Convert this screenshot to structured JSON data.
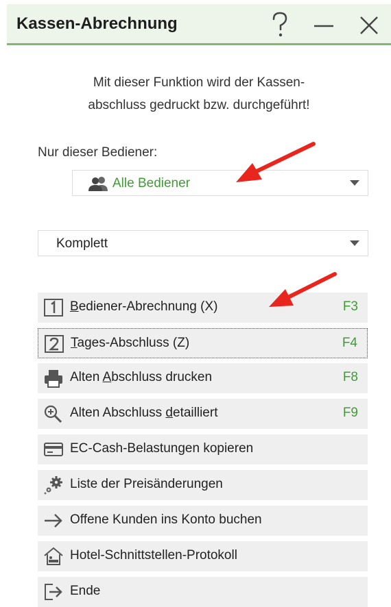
{
  "window": {
    "title": "Kassen-Abrechnung",
    "help_glyph": "?",
    "minimize_glyph": "—",
    "close_glyph": "✕"
  },
  "description": {
    "line1": "Mit dieser Funktion wird der Kassen-",
    "line2": "abschluss gedruckt bzw. durchgeführt!"
  },
  "operator_filter": {
    "label": "Nur dieser Bediener:",
    "selected": "Alle Bediener",
    "icon": "users-icon"
  },
  "mode_select": {
    "selected": "Komplett"
  },
  "actions": [
    {
      "pre": "",
      "ul": "B",
      "post": "ediener-Abrechnung (X)",
      "key": "F3",
      "icon": "number-1-icon"
    },
    {
      "pre": "",
      "ul": "T",
      "post": "ages-Abschluss (Z)",
      "key": "F4",
      "icon": "number-2-icon",
      "focused": true
    },
    {
      "pre": "Alten ",
      "ul": "A",
      "post": "bschluss drucken",
      "key": "F8",
      "icon": "printer-icon"
    },
    {
      "pre": "Alten Abschluss ",
      "ul": "d",
      "post": "etailliert",
      "key": "F9",
      "icon": "zoom-icon"
    },
    {
      "pre": "EC-Cash-Belastungen kopieren",
      "ul": "",
      "post": "",
      "key": "",
      "icon": "card-icon"
    },
    {
      "pre": "Liste der Preisänderungen",
      "ul": "",
      "post": "",
      "key": "",
      "icon": "gears-icon"
    },
    {
      "pre": "Offene Kunden ins Konto buchen",
      "ul": "",
      "post": "",
      "key": "",
      "icon": "arrow-right-icon"
    },
    {
      "pre": "Hotel-Schnittstellen-Protokoll",
      "ul": "",
      "post": "",
      "key": "",
      "icon": "hotel-icon"
    },
    {
      "pre": "Ende",
      "ul": "",
      "post": "",
      "key": "",
      "icon": "exit-icon"
    }
  ],
  "colors": {
    "accent_green": "#3f9c35",
    "title_bar": "#edf4ea",
    "title_border": "#7dbb6b",
    "annotation_arrow": "#e8261d"
  }
}
